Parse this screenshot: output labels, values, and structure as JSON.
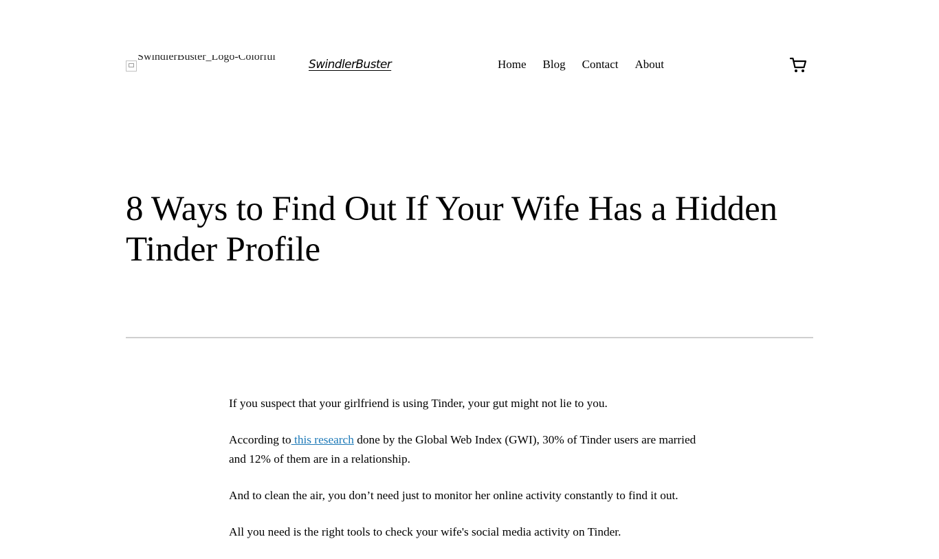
{
  "header": {
    "logo_alt": "SwindlerBuster_Logo-Colorful",
    "site_title": "SwindlerBuster",
    "nav": [
      "Home",
      "Blog",
      "Contact",
      "About"
    ],
    "cart_icon": "cart-icon"
  },
  "post": {
    "title": "8 Ways to Find Out If Your Wife Has a Hidden Tinder Profile",
    "p1": "If you suspect that your girlfriend is using Tinder, your gut might not lie to you.",
    "p2_before": "According to",
    "p2_link": " this research",
    "p2_after": " done by the Global Web Index (GWI), 30% of Tinder users are married and 12% of them are in a relationship.",
    "p3": "And to clean the air, you don’t need just to monitor her online activity constantly to find it out.",
    "p4_partial": "All you need is the right tools to check your wife's social media activity on Tinder."
  },
  "colors": {
    "link": "#1e7ab8",
    "divider": "#cfcfcf"
  }
}
